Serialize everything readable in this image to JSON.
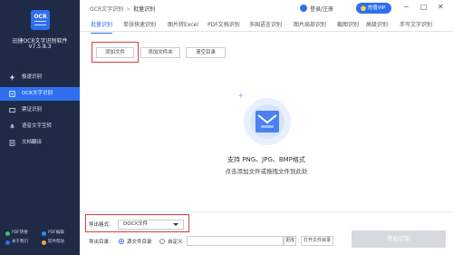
{
  "app": {
    "name": "迅捷OCR文字识别软件",
    "version": "V7.5.8.3",
    "logo_text": "OCR"
  },
  "sidebar": {
    "items": [
      {
        "label": "极速识别",
        "icon": "lightning-icon"
      },
      {
        "label": "OCR文字识别",
        "icon": "ocr-scan-icon"
      },
      {
        "label": "票证识别",
        "icon": "ticket-icon"
      },
      {
        "label": "语音文字互转",
        "icon": "microphone-icon"
      },
      {
        "label": "文档翻译",
        "icon": "translate-icon"
      }
    ],
    "bottom_links": [
      {
        "label": "PDF转换",
        "color": "#3bbf6f"
      },
      {
        "label": "PDF编辑",
        "color": "#2f8cf0"
      },
      {
        "label": "关于我们",
        "color": "#2f6fef"
      },
      {
        "label": "软件帮助",
        "color": "#f2a93b"
      }
    ]
  },
  "header": {
    "breadcrumb_root": "OCR文字识别",
    "breadcrumb_separator": ">",
    "breadcrumb_current": "批量识别",
    "login_label": "登录/注册",
    "vip_label": "充值VIP",
    "window_controls": [
      "─",
      "□",
      "✕"
    ]
  },
  "tabs": [
    "批量识别",
    "单张快速识别",
    "图片转Excel",
    "PDF文档识别",
    "多国语言识别",
    "图片局部识别",
    "截图识别",
    "高级识别",
    "手写文字识别"
  ],
  "toolbar": {
    "add_file": "添加文件",
    "add_folder": "添加文件夹",
    "clear_list": "清空目录"
  },
  "drop_area": {
    "plus": "+",
    "formats": "支持 PNG、JPG、BMP格式",
    "hint": "点击添加文件或拖拽文件到此处"
  },
  "options": {
    "format_label": "导出格式:",
    "format_value": "DOCX文件",
    "dir_label": "导出目录:",
    "radio_source": "源文件目录",
    "radio_custom": "自定义",
    "path_value": "",
    "change_btn": "更改",
    "open_folder_btn": "打开文件目录",
    "start_btn": "开始识别"
  },
  "colors": {
    "accent": "#2f6fef",
    "sidebar_bg": "#1f2b46",
    "highlight": "#e03b3b"
  }
}
